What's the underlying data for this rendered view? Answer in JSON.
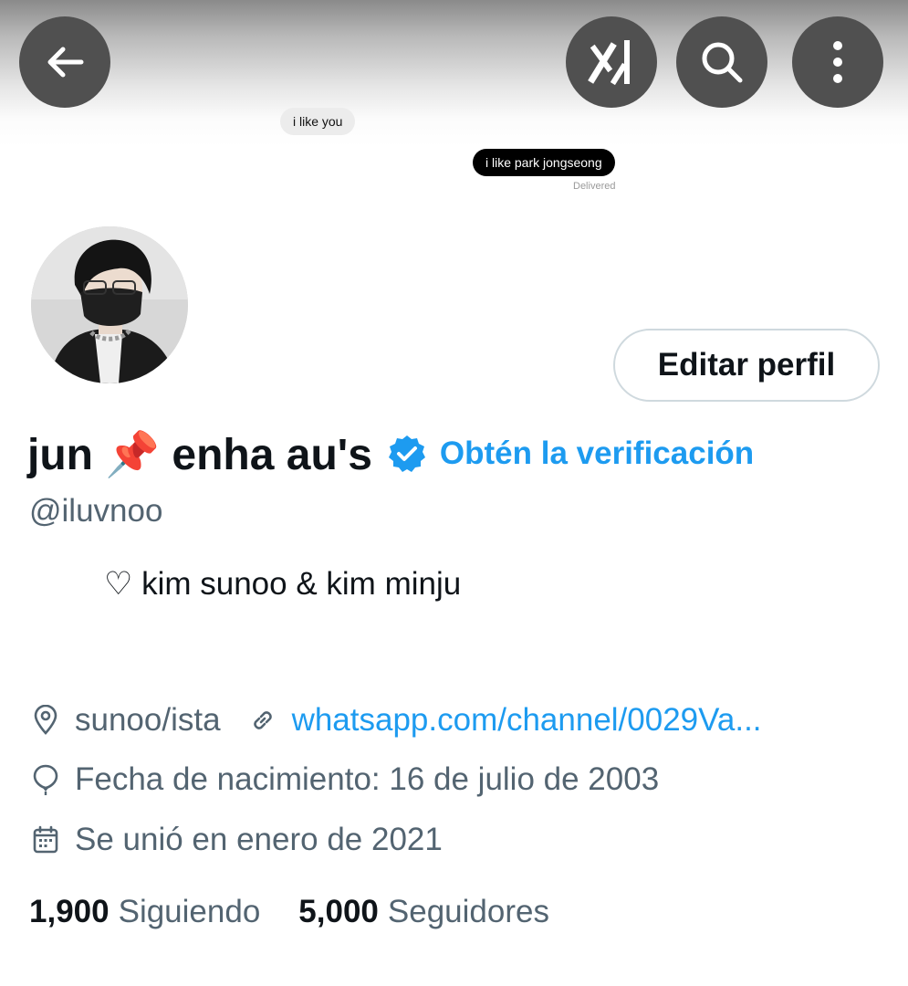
{
  "banner": {
    "message_in": "i like you",
    "message_out": "i like park jongseong",
    "status": "Delivered"
  },
  "header": {
    "back_icon": "arrow-left-icon",
    "grok_icon": "grok-icon",
    "search_icon": "search-icon",
    "more_icon": "more-vertical-icon"
  },
  "profile": {
    "edit_button": "Editar perfil",
    "name": "jun 📌 enha au's",
    "verified_icon": "verified-badge-icon",
    "get_verified": "Obtén la verificación",
    "handle": "@iluvnoo",
    "bio": "♡ kim sunoo & kim minju",
    "location": "sunoo/ista",
    "website": "whatsapp.com/channel/0029Va...",
    "birthday": "Fecha de nacimiento: 16 de julio de 2003",
    "joined": "Se unió en enero de 2021",
    "following_count": "1,900",
    "following_label": "Siguiendo",
    "followers_count": "5,000",
    "followers_label": "Seguidores"
  },
  "colors": {
    "accent": "#1d9bf0",
    "text": "#0f1419",
    "muted": "#536471",
    "header_button": "#505050"
  }
}
